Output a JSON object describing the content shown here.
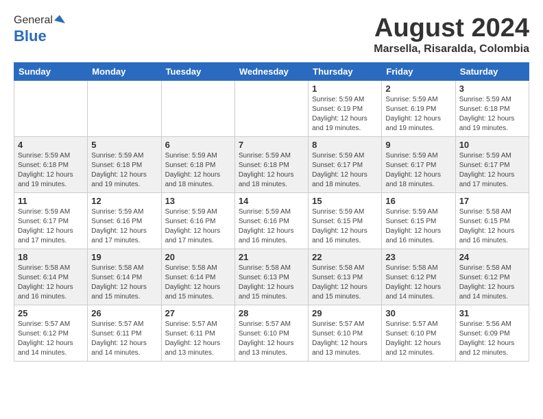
{
  "header": {
    "logo_general": "General",
    "logo_blue": "Blue",
    "month_title": "August 2024",
    "location": "Marsella, Risaralda, Colombia"
  },
  "calendar": {
    "days_of_week": [
      "Sunday",
      "Monday",
      "Tuesday",
      "Wednesday",
      "Thursday",
      "Friday",
      "Saturday"
    ],
    "weeks": [
      {
        "days": [
          {
            "num": "",
            "info": ""
          },
          {
            "num": "",
            "info": ""
          },
          {
            "num": "",
            "info": ""
          },
          {
            "num": "",
            "info": ""
          },
          {
            "num": "1",
            "info": "Sunrise: 5:59 AM\nSunset: 6:19 PM\nDaylight: 12 hours\nand 19 minutes."
          },
          {
            "num": "2",
            "info": "Sunrise: 5:59 AM\nSunset: 6:19 PM\nDaylight: 12 hours\nand 19 minutes."
          },
          {
            "num": "3",
            "info": "Sunrise: 5:59 AM\nSunset: 6:18 PM\nDaylight: 12 hours\nand 19 minutes."
          }
        ]
      },
      {
        "days": [
          {
            "num": "4",
            "info": "Sunrise: 5:59 AM\nSunset: 6:18 PM\nDaylight: 12 hours\nand 19 minutes."
          },
          {
            "num": "5",
            "info": "Sunrise: 5:59 AM\nSunset: 6:18 PM\nDaylight: 12 hours\nand 19 minutes."
          },
          {
            "num": "6",
            "info": "Sunrise: 5:59 AM\nSunset: 6:18 PM\nDaylight: 12 hours\nand 18 minutes."
          },
          {
            "num": "7",
            "info": "Sunrise: 5:59 AM\nSunset: 6:18 PM\nDaylight: 12 hours\nand 18 minutes."
          },
          {
            "num": "8",
            "info": "Sunrise: 5:59 AM\nSunset: 6:17 PM\nDaylight: 12 hours\nand 18 minutes."
          },
          {
            "num": "9",
            "info": "Sunrise: 5:59 AM\nSunset: 6:17 PM\nDaylight: 12 hours\nand 18 minutes."
          },
          {
            "num": "10",
            "info": "Sunrise: 5:59 AM\nSunset: 6:17 PM\nDaylight: 12 hours\nand 17 minutes."
          }
        ]
      },
      {
        "days": [
          {
            "num": "11",
            "info": "Sunrise: 5:59 AM\nSunset: 6:17 PM\nDaylight: 12 hours\nand 17 minutes."
          },
          {
            "num": "12",
            "info": "Sunrise: 5:59 AM\nSunset: 6:16 PM\nDaylight: 12 hours\nand 17 minutes."
          },
          {
            "num": "13",
            "info": "Sunrise: 5:59 AM\nSunset: 6:16 PM\nDaylight: 12 hours\nand 17 minutes."
          },
          {
            "num": "14",
            "info": "Sunrise: 5:59 AM\nSunset: 6:16 PM\nDaylight: 12 hours\nand 16 minutes."
          },
          {
            "num": "15",
            "info": "Sunrise: 5:59 AM\nSunset: 6:15 PM\nDaylight: 12 hours\nand 16 minutes."
          },
          {
            "num": "16",
            "info": "Sunrise: 5:59 AM\nSunset: 6:15 PM\nDaylight: 12 hours\nand 16 minutes."
          },
          {
            "num": "17",
            "info": "Sunrise: 5:58 AM\nSunset: 6:15 PM\nDaylight: 12 hours\nand 16 minutes."
          }
        ]
      },
      {
        "days": [
          {
            "num": "18",
            "info": "Sunrise: 5:58 AM\nSunset: 6:14 PM\nDaylight: 12 hours\nand 16 minutes."
          },
          {
            "num": "19",
            "info": "Sunrise: 5:58 AM\nSunset: 6:14 PM\nDaylight: 12 hours\nand 15 minutes."
          },
          {
            "num": "20",
            "info": "Sunrise: 5:58 AM\nSunset: 6:14 PM\nDaylight: 12 hours\nand 15 minutes."
          },
          {
            "num": "21",
            "info": "Sunrise: 5:58 AM\nSunset: 6:13 PM\nDaylight: 12 hours\nand 15 minutes."
          },
          {
            "num": "22",
            "info": "Sunrise: 5:58 AM\nSunset: 6:13 PM\nDaylight: 12 hours\nand 15 minutes."
          },
          {
            "num": "23",
            "info": "Sunrise: 5:58 AM\nSunset: 6:12 PM\nDaylight: 12 hours\nand 14 minutes."
          },
          {
            "num": "24",
            "info": "Sunrise: 5:58 AM\nSunset: 6:12 PM\nDaylight: 12 hours\nand 14 minutes."
          }
        ]
      },
      {
        "days": [
          {
            "num": "25",
            "info": "Sunrise: 5:57 AM\nSunset: 6:12 PM\nDaylight: 12 hours\nand 14 minutes."
          },
          {
            "num": "26",
            "info": "Sunrise: 5:57 AM\nSunset: 6:11 PM\nDaylight: 12 hours\nand 14 minutes."
          },
          {
            "num": "27",
            "info": "Sunrise: 5:57 AM\nSunset: 6:11 PM\nDaylight: 12 hours\nand 13 minutes."
          },
          {
            "num": "28",
            "info": "Sunrise: 5:57 AM\nSunset: 6:10 PM\nDaylight: 12 hours\nand 13 minutes."
          },
          {
            "num": "29",
            "info": "Sunrise: 5:57 AM\nSunset: 6:10 PM\nDaylight: 12 hours\nand 13 minutes."
          },
          {
            "num": "30",
            "info": "Sunrise: 5:57 AM\nSunset: 6:10 PM\nDaylight: 12 hours\nand 12 minutes."
          },
          {
            "num": "31",
            "info": "Sunrise: 5:56 AM\nSunset: 6:09 PM\nDaylight: 12 hours\nand 12 minutes."
          }
        ]
      }
    ]
  }
}
